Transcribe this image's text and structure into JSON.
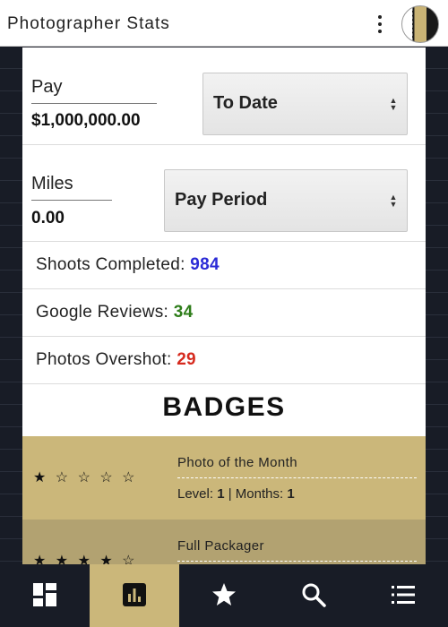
{
  "app": {
    "title": "Photographer Stats"
  },
  "header": {
    "menu_icon": "kebab-menu-icon",
    "avatar_icon": "profile-avatar"
  },
  "pay": {
    "label": "Pay",
    "value": "$1,000,000.00",
    "period_select": "To Date"
  },
  "miles": {
    "label": "Miles",
    "value": "0.00",
    "period_select": "Pay Period"
  },
  "stats": [
    {
      "label": "Shoots Completed: ",
      "value": "984",
      "color": "#2b2bd6"
    },
    {
      "label": "Google Reviews: ",
      "value": "34",
      "color": "#2e7d1a"
    },
    {
      "label": "Photos Overshot: ",
      "value": "29",
      "color": "#d62a1e"
    }
  ],
  "badges": {
    "title": "BADGES",
    "items": [
      {
        "stars": "★ ☆ ☆ ☆ ☆",
        "rating": 1,
        "name": "Photo of the Month",
        "level_label": "Level: ",
        "level": "1",
        "sep": " | ",
        "months_label": "Months: ",
        "months": "1",
        "bg": "#cbb77a"
      },
      {
        "stars": "★ ★ ★ ★ ☆",
        "rating": 4,
        "name": "Full Packager",
        "bg": "#b2a271"
      }
    ]
  },
  "nav": {
    "items": [
      {
        "name": "dashboard",
        "icon": "dashboard-icon",
        "active": false
      },
      {
        "name": "stats",
        "icon": "bar-chart-icon",
        "active": true
      },
      {
        "name": "badges",
        "icon": "star-icon",
        "active": false
      },
      {
        "name": "search",
        "icon": "search-icon",
        "active": false
      },
      {
        "name": "menu",
        "icon": "list-icon",
        "active": false
      }
    ]
  },
  "colors": {
    "accent": "#cbb77a",
    "dark": "#181c26"
  }
}
